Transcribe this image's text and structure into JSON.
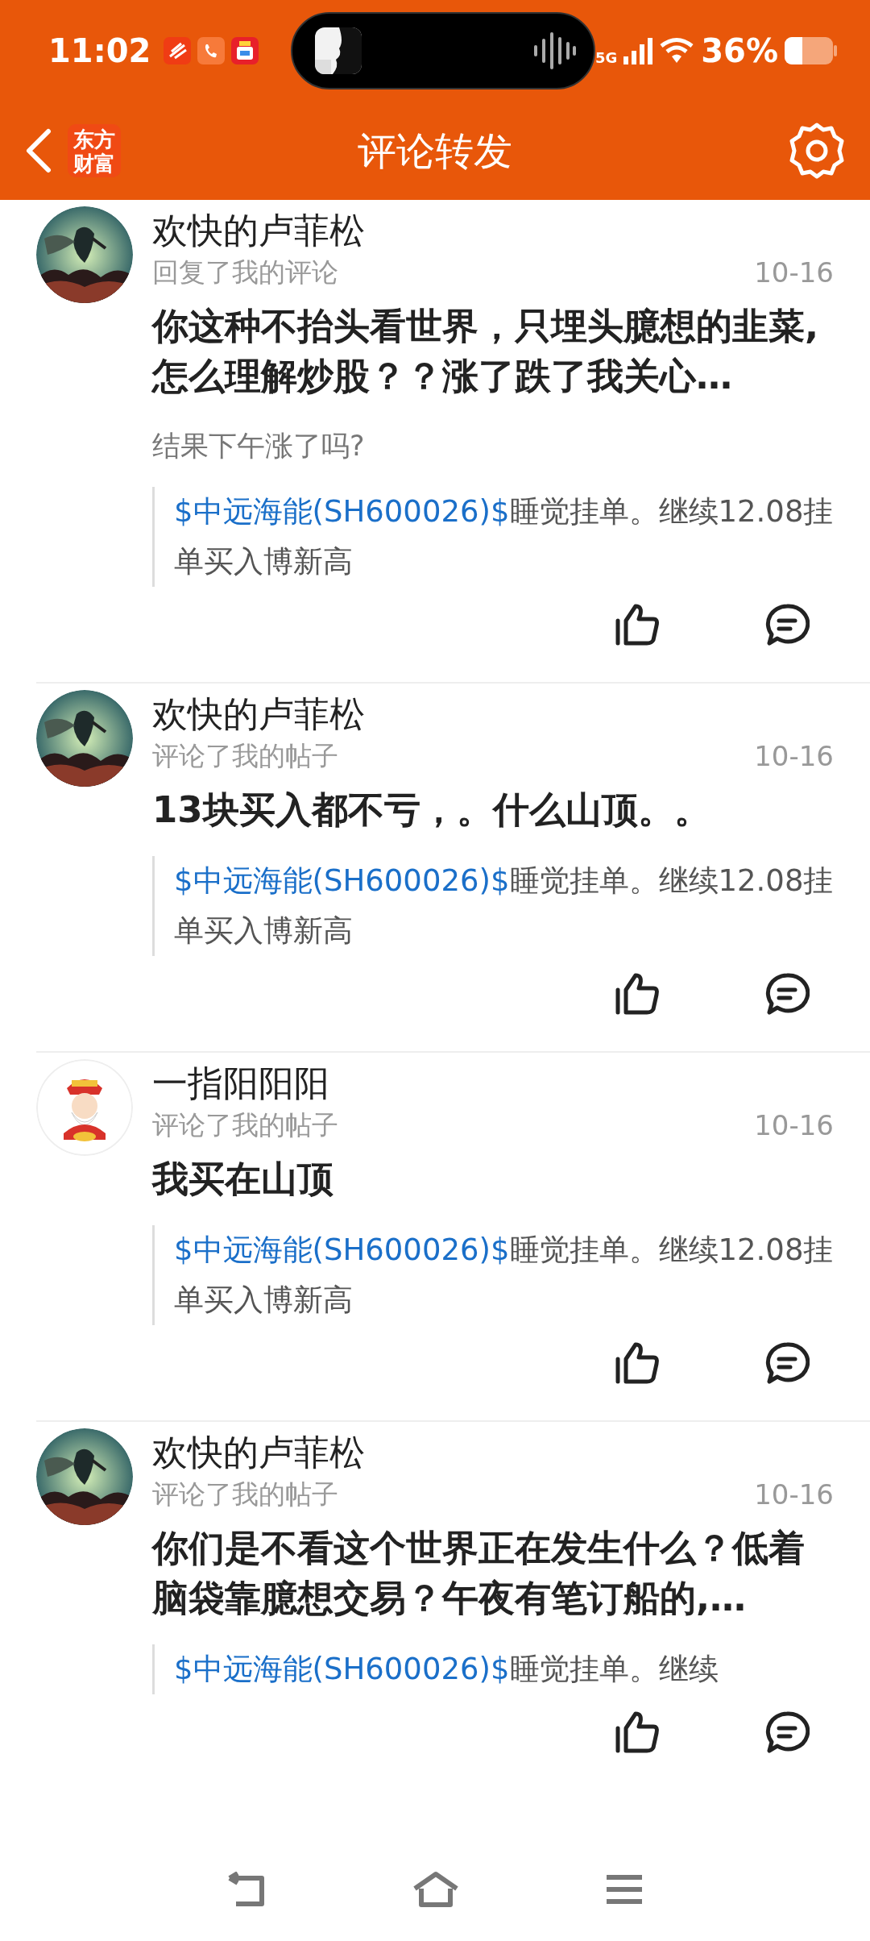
{
  "status_bar": {
    "time": "11:02",
    "network": "5G",
    "battery": "36%"
  },
  "header": {
    "logo": "东方财富",
    "title": "评论转发"
  },
  "items": [
    {
      "name": "欢快的卢菲松",
      "action": "回复了我的评论",
      "date": "10-16",
      "content": "你这种不抬头看世界，只埋头臆想的韭菜,怎么理解炒股？？涨了跌了我关心…",
      "reply": "结果下午涨了吗?",
      "quote_link": "$中远海能(SH600026)$",
      "quote_text": "睡觉挂单。继续12.08挂单买入博新高"
    },
    {
      "name": "欢快的卢菲松",
      "action": "评论了我的帖子",
      "date": "10-16",
      "content": "13块买入都不亏，。什么山顶。。",
      "quote_link": "$中远海能(SH600026)$",
      "quote_text": "睡觉挂单。继续12.08挂单买入博新高"
    },
    {
      "kind": "cartoon",
      "name": "一指阳阳阳",
      "action": "评论了我的帖子",
      "date": "10-16",
      "content": "我买在山顶",
      "quote_link": "$中远海能(SH600026)$",
      "quote_text": "睡觉挂单。继续12.08挂单买入博新高"
    },
    {
      "name": "欢快的卢菲松",
      "action": "评论了我的帖子",
      "date": "10-16",
      "content": "你们是不看这个世界正在发生什么？低着脑袋靠臆想交易？午夜有笔订船的,…",
      "quote_link": "$中远海能(SH600026)$",
      "quote_text": "睡觉挂单。继续"
    }
  ]
}
